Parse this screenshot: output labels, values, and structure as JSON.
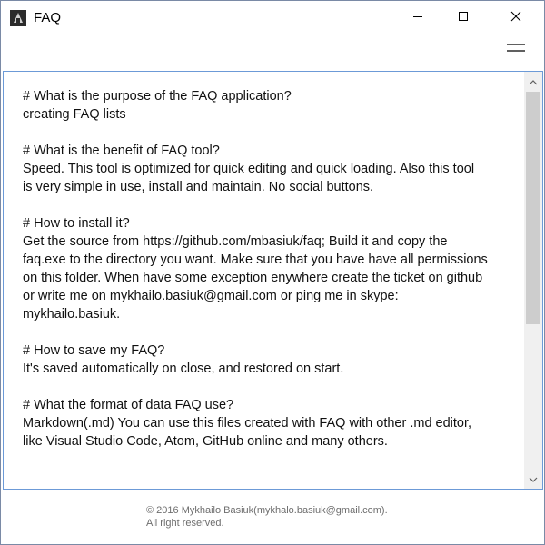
{
  "window": {
    "title": "FAQ",
    "icon": "app-icon",
    "controls": [
      "minimize-icon",
      "maximize-icon",
      "close-icon"
    ]
  },
  "toolbar": {
    "menu_icon": "hamburger-menu-icon"
  },
  "content": {
    "lines": [
      "# What is the purpose of the FAQ application?",
      "creating FAQ lists",
      "",
      "# What is the benefit of FAQ tool?",
      "Speed. This tool is optimized for quick editing and quick loading. Also this tool",
      "is very simple in use, install and maintain. No social buttons.",
      "",
      "# How to install it?",
      "Get the source from https://github.com/mbasiuk/faq; Build it and copy the",
      "faq.exe to the directory you want. Make sure that you have have all permissions",
      "on this folder. When have some exception enywhere create the ticket on github",
      "or write me on mykhailo.basiuk@gmail.com or ping me in skype:",
      "mykhailo.basiuk.",
      "",
      "# How to save my FAQ?",
      "It's saved automatically on close, and restored on start.",
      "",
      "# What the format of data FAQ use?",
      "Markdown(.md) You can use this files created with FAQ with other .md editor,",
      "like Visual Studio Code, Atom, GitHub online and many others."
    ]
  },
  "footer": {
    "copyright": "© 2016 Mykhailo Basiuk(mykhalo.basiuk@gmail.com).",
    "rights": "All right reserved."
  },
  "colors": {
    "content_border": "#6c9ad7",
    "scroll_thumb": "#cdcdcd",
    "footer_text": "#6d6d6d"
  }
}
